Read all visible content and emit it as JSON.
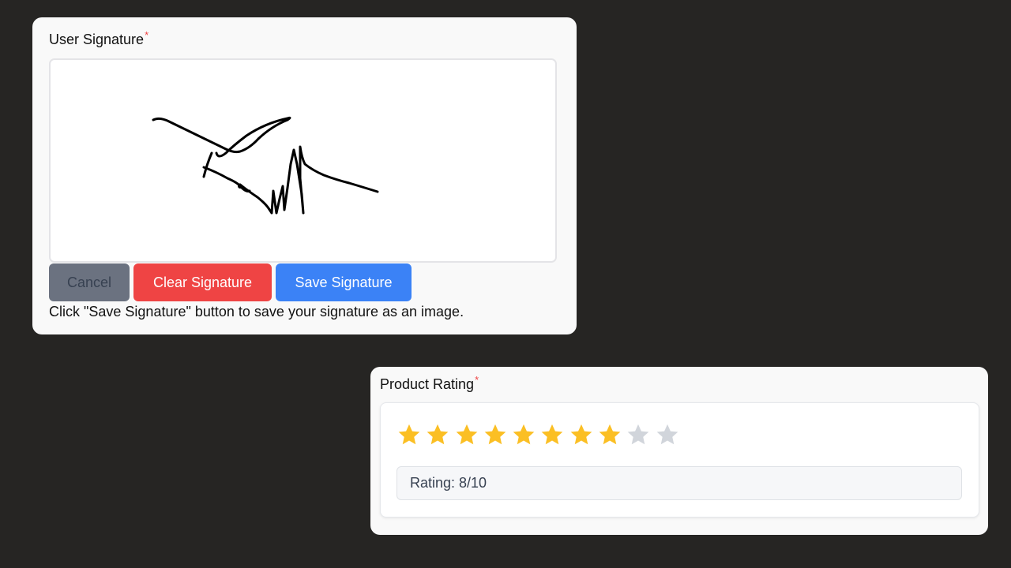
{
  "signature_field": {
    "label": "User Signature",
    "required_mark": "*",
    "buttons": {
      "cancel": "Cancel",
      "clear": "Clear Signature",
      "save": "Save Signature"
    },
    "hint": "Click \"Save Signature\" button to save your signature as an image."
  },
  "rating_field": {
    "label": "Product Rating",
    "required_mark": "*",
    "rating_value": 8,
    "rating_max": 10,
    "rating_text": "Rating: 8/10"
  },
  "colors": {
    "background": "#262523",
    "required": "#ef4444",
    "cancel_button": "#6b7280",
    "clear_button": "#ef4444",
    "save_button": "#3b82f6",
    "star_filled": "#fbbf24",
    "star_empty": "#d1d5db"
  },
  "icons": {
    "star": "star-icon"
  }
}
